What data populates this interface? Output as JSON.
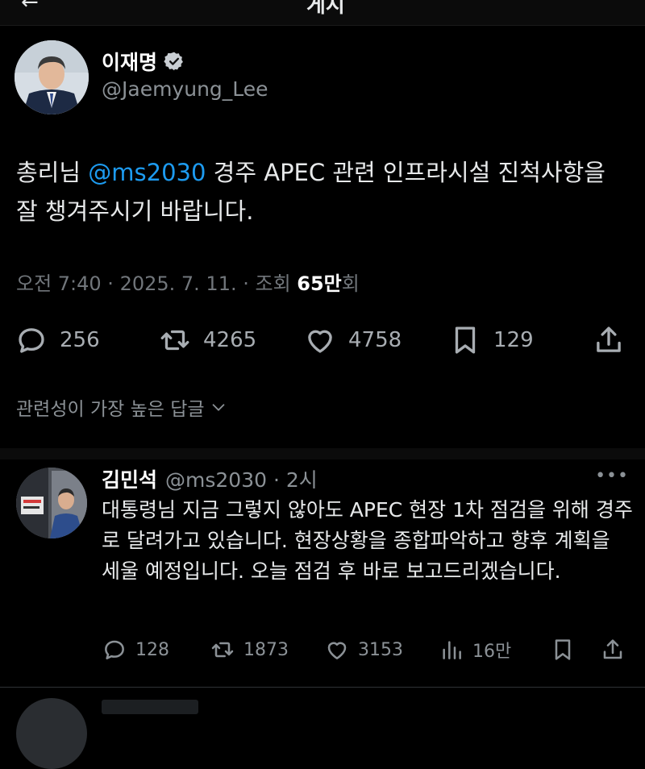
{
  "header": {
    "back_glyph": "←",
    "title": "게시"
  },
  "post": {
    "author_name": "이재명",
    "author_handle": "@Jaemyung_Lee",
    "text_before": "총리님 ",
    "mention": "@ms2030",
    "text_after": " 경주 APEC 관련 인프라시설 진척사항을 잘 챙겨주시기 바랍니다.",
    "meta_time": "오전 7:40 · 2025. 7. 11. · 조회 ",
    "views": "65만",
    "views_suffix": "회",
    "replies": "256",
    "reposts": "4265",
    "likes": "4758",
    "bookmarks": "129"
  },
  "replies_sort": {
    "label": "관련성이 가장 높은 답글"
  },
  "reply": {
    "name": "김민석",
    "handle_time": "@ms2030 · 2시",
    "text": "대통령님 지금 그렇지 않아도 APEC 현장 1차 점검을 위해 경주로 달려가고 있습니다. 현장상황을 종합파악하고 향후 계획을 세울 예정입니다. 오늘 점검 후 바로 보고드리겠습니다.",
    "replies": "128",
    "reposts": "1873",
    "likes": "3153",
    "views": "16만"
  },
  "colors": {
    "accent": "#1d9bf0",
    "background": "#000000",
    "muted": "#71767b"
  }
}
